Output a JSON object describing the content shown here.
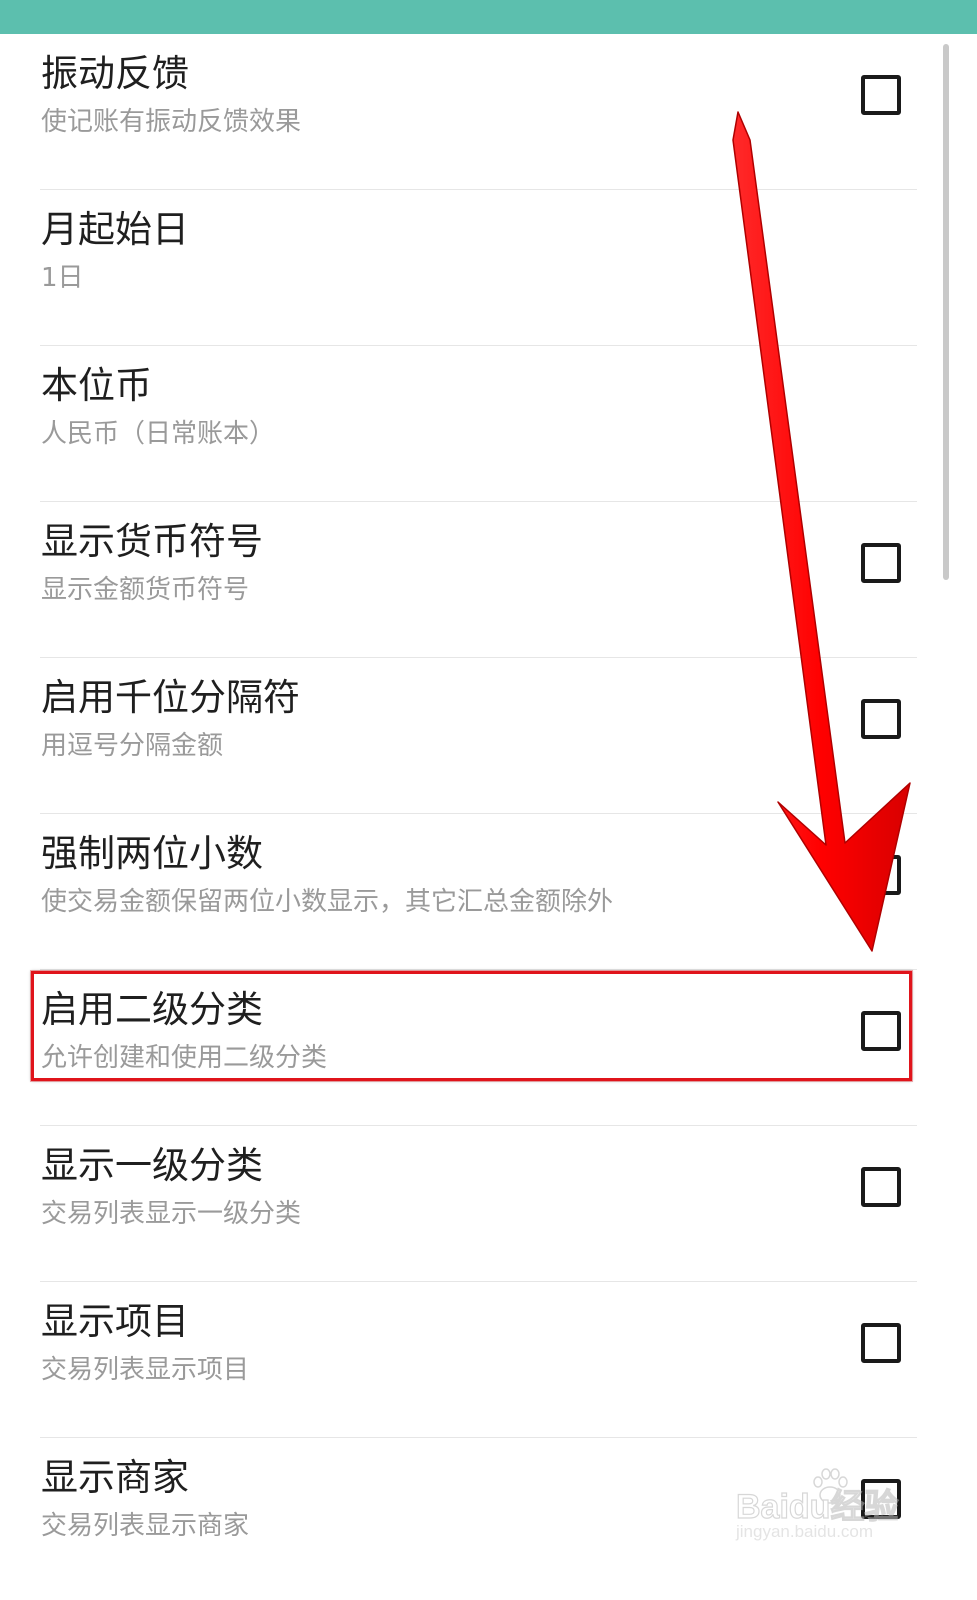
{
  "status_bar": {
    "color": "#5cbfae"
  },
  "settings": [
    {
      "title": "振动反馈",
      "desc": "使记账有振动反馈效果",
      "has_checkbox": true,
      "checked": false
    },
    {
      "title": "月起始日",
      "desc": "1日",
      "has_checkbox": false
    },
    {
      "title": "本位币",
      "desc": "人民币（日常账本）",
      "has_checkbox": false
    },
    {
      "title": "显示货币符号",
      "desc": "显示金额货币符号",
      "has_checkbox": true,
      "checked": false
    },
    {
      "title": "启用千位分隔符",
      "desc": "用逗号分隔金额",
      "has_checkbox": true,
      "checked": false
    },
    {
      "title": "强制两位小数",
      "desc": "使交易金额保留两位小数显示，其它汇总金额除外",
      "has_checkbox": true,
      "checked": false
    },
    {
      "title": "启用二级分类",
      "desc": "允许创建和使用二级分类",
      "has_checkbox": true,
      "checked": false,
      "highlighted": true
    },
    {
      "title": "显示一级分类",
      "desc": "交易列表显示一级分类",
      "has_checkbox": true,
      "checked": false
    },
    {
      "title": "显示项目",
      "desc": "交易列表显示项目",
      "has_checkbox": true,
      "checked": false
    },
    {
      "title": "显示商家",
      "desc": "交易列表显示商家",
      "has_checkbox": true,
      "checked": false
    }
  ],
  "annotation": {
    "arrow_color": "#ff0000",
    "highlight_color": "#e0141b"
  },
  "watermark": {
    "main": "Baidu经验",
    "sub": "jingyan.baidu.com"
  }
}
